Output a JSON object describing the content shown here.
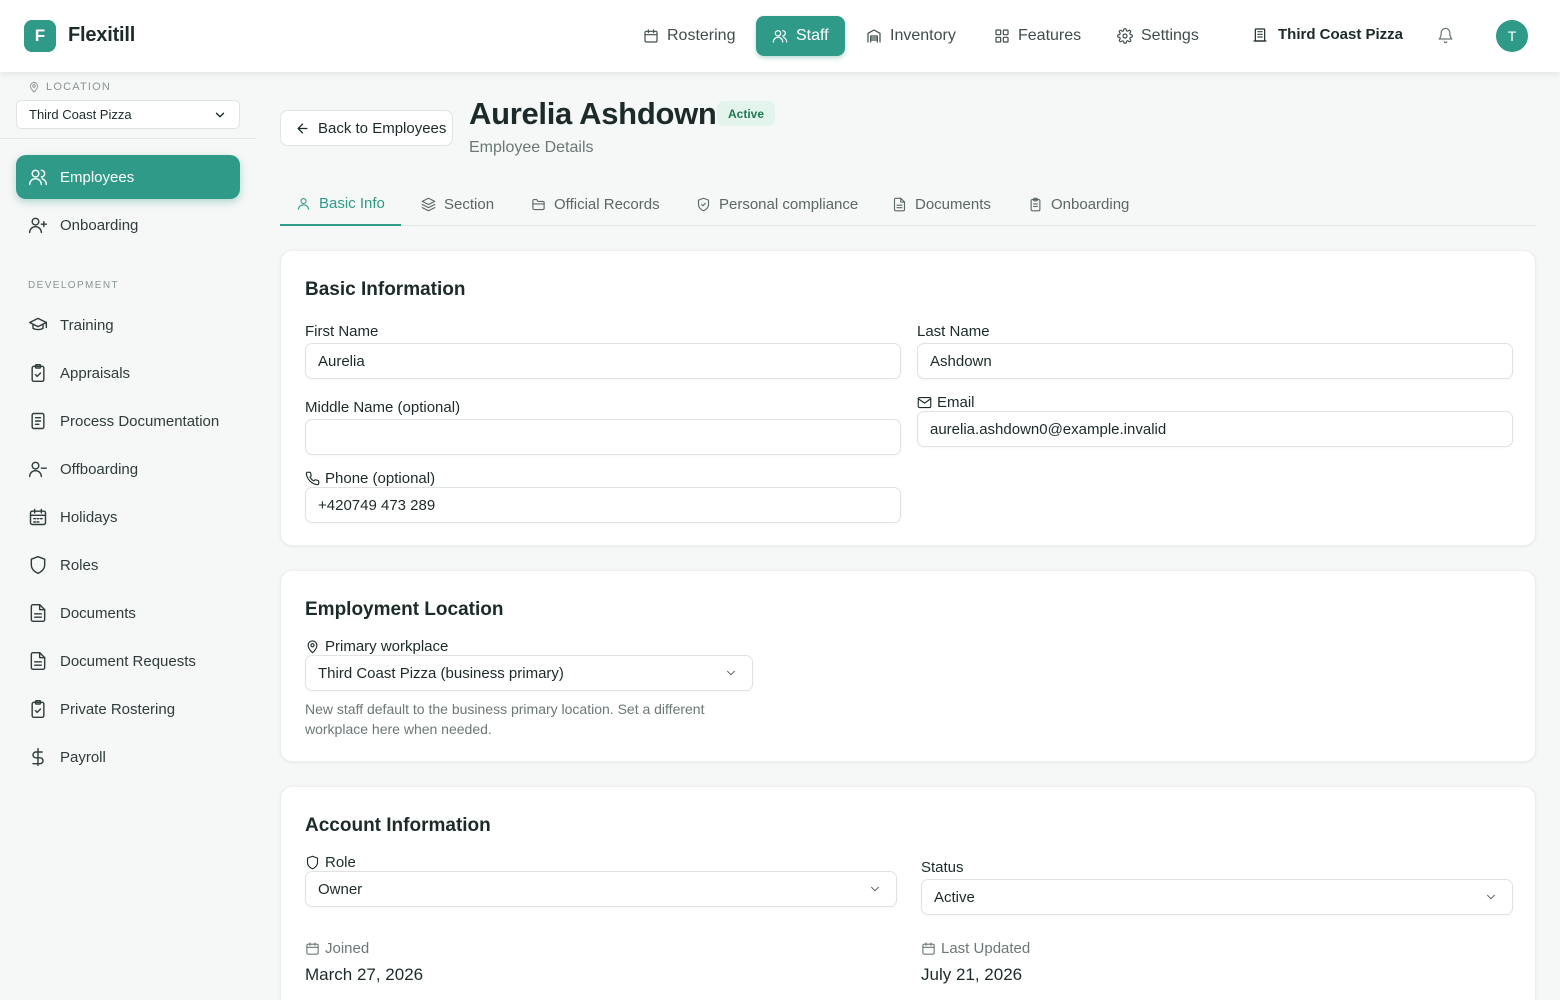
{
  "app": {
    "logo_letter": "F",
    "name": "Flexitill"
  },
  "nav": [
    {
      "label": "Rostering",
      "icon": "calendar-icon"
    },
    {
      "label": "Staff",
      "icon": "users-icon",
      "active": true
    },
    {
      "label": "Inventory",
      "icon": "warehouse-icon"
    },
    {
      "label": "Features",
      "icon": "grid-icon"
    },
    {
      "label": "Settings",
      "icon": "gear-icon"
    }
  ],
  "business": {
    "name": "Third Coast Pizza"
  },
  "user": {
    "avatar_letter": "T"
  },
  "sidebar": {
    "location_label": "LOCATION",
    "location_value": "Third Coast Pizza",
    "items_top": [
      {
        "label": "Employees",
        "active": true
      },
      {
        "label": "Onboarding"
      }
    ],
    "section_label": "DEVELOPMENT",
    "items_dev": [
      {
        "label": "Training"
      },
      {
        "label": "Appraisals"
      },
      {
        "label": "Process Documentation"
      },
      {
        "label": "Offboarding"
      },
      {
        "label": "Holidays"
      },
      {
        "label": "Roles"
      },
      {
        "label": "Documents"
      },
      {
        "label": "Document Requests"
      },
      {
        "label": "Private Rostering"
      },
      {
        "label": "Payroll"
      }
    ]
  },
  "page": {
    "back_label": "Back to Employees",
    "employee_name": "Aurelia Ashdown",
    "status_badge": "Active",
    "subtitle": "Employee Details"
  },
  "tabs": [
    {
      "label": "Basic Info",
      "active": true
    },
    {
      "label": "Section"
    },
    {
      "label": "Official Records"
    },
    {
      "label": "Personal compliance"
    },
    {
      "label": "Documents"
    },
    {
      "label": "Onboarding"
    }
  ],
  "basic_info": {
    "title": "Basic Information",
    "first_name_label": "First Name",
    "first_name_value": "Aurelia",
    "last_name_label": "Last Name",
    "last_name_value": "Ashdown",
    "middle_name_label": "Middle Name (optional)",
    "middle_name_value": "",
    "email_label": "Email",
    "email_value": "aurelia.ashdown0@example.invalid",
    "phone_label": "Phone (optional)",
    "phone_value": "+420749 473 289"
  },
  "employment_location": {
    "title": "Employment Location",
    "workplace_label": "Primary workplace",
    "workplace_value": "Third Coast Pizza (business primary)",
    "help_text": "New staff default to the business primary location. Set a different workplace here when needed."
  },
  "account_info": {
    "title": "Account Information",
    "role_label": "Role",
    "role_value": "Owner",
    "status_label": "Status",
    "status_value": "Active",
    "joined_label": "Joined",
    "joined_value": "March 27, 2026",
    "updated_label": "Last Updated",
    "updated_value": "July 21, 2026"
  },
  "colors": {
    "accent": "#2e9a87",
    "badge_bg": "#e2f4ec",
    "badge_text": "#1f7a50"
  }
}
